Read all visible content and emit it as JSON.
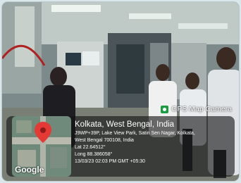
{
  "photo": {
    "description_icon": "factory-lab-photo"
  },
  "stamp": {
    "app_label": "GPS Map Camera",
    "app_icon": "camera-icon"
  },
  "location": {
    "title": "Kolkata, West Bengal, India",
    "address_line1": "J9WP+39P, Lake View Park, Satin Sen Nagar, Kolkata,",
    "address_line2": "West Bengal 700108, India",
    "lat": "Lat 22.64512°",
    "long": "Long 88.386058°",
    "timestamp": "13/03/23 02:03 PM GMT +05:30"
  },
  "map": {
    "logo_text": "Google",
    "pin_icon": "map-pin-icon",
    "pin_color": "#e53935"
  }
}
